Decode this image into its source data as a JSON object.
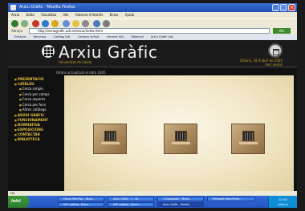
{
  "browser": {
    "title": "Arxiu Gràfic - Mozilla Firefox",
    "menu": [
      "Arxiu",
      "Edita",
      "Visualitza",
      "Vés",
      "Adreces d'interès",
      "Eines",
      "Ajuda"
    ],
    "address_label": "Adreça",
    "url": "http://arxiugrafic.udl.es/arxiu/index.html",
    "go_label": "Vés",
    "links": [
      "Enllaços",
      "Recursos",
      "Catàleg UdL",
      "Campus virtual",
      "Intranet UdL",
      "Webmail",
      "Arxiu Gràfic UdL"
    ]
  },
  "page": {
    "site_title": "Arxiu Gràfic",
    "subtitle": "Universitat de Lleida",
    "date": "Dilluns, 18 d'abril de 2005",
    "user": "Inici sessió",
    "update_note": "Últims actualitzat el data 2005",
    "sidebar": [
      {
        "label": "PRESENTACIÓ",
        "sub": []
      },
      {
        "label": "CATÀLEG",
        "sub": [
          "Cerca simple",
          "Cerca per camps",
          "Cerca experta",
          "Cerca per fons",
          "Altres catàlegs"
        ]
      },
      {
        "label": "ARXIU GRÀFIC",
        "sub": []
      },
      {
        "label": "FUNCIONAMENT",
        "sub": []
      },
      {
        "label": "NORMATIVA",
        "sub": []
      },
      {
        "label": "EXPOSICIONS",
        "sub": []
      },
      {
        "label": "CONTACTAR",
        "sub": []
      },
      {
        "label": "BIBLIOTECA",
        "sub": []
      }
    ]
  },
  "status": {
    "text": "Fet"
  },
  "taskbar": {
    "start": "inici",
    "tasks_row1": [
      "Fòrum Mail Pop - Micro...",
      "Arxiu Gràfic - 2 - Mi...",
      "2 Explorador - Micro...",
      "Microsoft PowerPoint..."
    ],
    "tasks_row2": [
      "UPF catàleg - Micro...",
      "UPF catàleg - Micro...",
      "Arxiu Gràfic - Mozilla"
    ],
    "time": "12:45",
    "day": "dilluns"
  }
}
